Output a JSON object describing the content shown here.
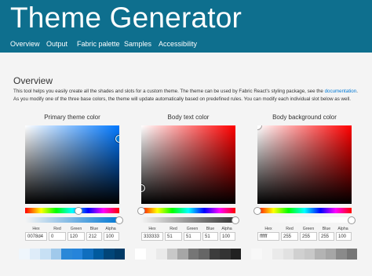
{
  "header": {
    "title": "Theme Generator",
    "nav": [
      "Overview",
      "Output",
      "Fabric palette",
      "Samples",
      "Accessibility"
    ],
    "background": "#0e6f8e"
  },
  "overview": {
    "title": "Overview",
    "desc_before_link": "This tool helps you easily create all the shades and slots for a custom theme. The theme can be used by Fabric React's styling package, see the ",
    "link": "documentation",
    "desc_after_link": ".",
    "desc_line2": "As you modify one of the three base colors, the theme will update automatically based on predefined rules. You can modify each individual slot below as well."
  },
  "field_labels": [
    "Hex",
    "Red",
    "Green",
    "Blue",
    "Alpha"
  ],
  "pickers": [
    {
      "title": "Primary theme color",
      "hue_color": "#0078ff",
      "hue_fraction": 0.57,
      "alpha_fraction": 1.0,
      "saturation_fraction": 1.0,
      "value_fraction": 0.83,
      "hex": "0078d4",
      "red": "0",
      "green": "120",
      "blue": "212",
      "alpha": "100",
      "swatches": [
        "#eff6fc",
        "#deecf9",
        "#c7e0f4",
        "#a0c9eb",
        "#2b88d8",
        "#2684da",
        "#106ebe",
        "#005a9e",
        "#004578",
        "#003a66"
      ]
    },
    {
      "title": "Body text color",
      "hue_color": "#ff0000",
      "hue_fraction": 0.0,
      "alpha_fraction": 1.0,
      "saturation_fraction": 0.0,
      "value_fraction": 0.2,
      "hex": "333333",
      "red": "51",
      "green": "51",
      "blue": "51",
      "alpha": "100",
      "swatches": [
        "#ffffff",
        "#f4f4f4",
        "#eaeaea",
        "#c8c8c8",
        "#a6a6a6",
        "#767676",
        "#666666",
        "#3c3c3c",
        "#333333",
        "#212121"
      ]
    },
    {
      "title": "Body background color",
      "hue_color": "#ff0000",
      "hue_fraction": 0.0,
      "alpha_fraction": 1.0,
      "saturation_fraction": 0.0,
      "value_fraction": 1.0,
      "hex": "ffffff",
      "red": "255",
      "green": "255",
      "blue": "255",
      "alpha": "100",
      "swatches": [
        "#f8f8f8",
        "#f4f4f4",
        "#eaeaea",
        "#e1e1e1",
        "#d0d0d0",
        "#c8c8c8",
        "#b3b3b3",
        "#a6a6a6",
        "#8a8a8a",
        "#767676"
      ]
    }
  ]
}
